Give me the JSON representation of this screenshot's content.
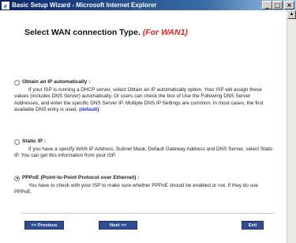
{
  "window": {
    "title": "Basic Setup Wizard - Microsoft Internet Explorer",
    "minimize": "_",
    "maximize": "□",
    "close": "×"
  },
  "page": {
    "heading": "Select WAN connection Type.",
    "heading_wan": "(For WAN1)"
  },
  "options": [
    {
      "title": "Obtain an IP automatically :",
      "selected": false,
      "description": "If your ISP is running a DHCP server, select Obtain an IP automatically option. Your ISP will assign these values (includes DNS Server) automatically. Or users can check the box of Use the Following DNS Server Addresses, and enter the specific DNS Server IP. Multiple DNS IP Settings are common. In most cases, the first available DNS entry is used.",
      "link": "(default)"
    },
    {
      "title": "Static IP :",
      "selected": false,
      "description": "If you have a specify WAN IP Address, Subnet Mask, Default Gateway Address and DNS Server, select Static IP. You can get this information from your ISP."
    },
    {
      "title": "PPPoE (Point-to-Point Protocol over Ethernet) :",
      "selected": true,
      "description": "You have to check with your ISP to make sure whether PPPoE should be enabled or not. If they do use PPPoE."
    }
  ],
  "buttons": {
    "previous": "<< Previous",
    "next": "Next >>",
    "exit": "Exit"
  },
  "colors": {
    "titlebar": "#0a246a",
    "heading_accent": "#e8241c",
    "link": "#1a35c8",
    "button": "#2e4d93"
  }
}
